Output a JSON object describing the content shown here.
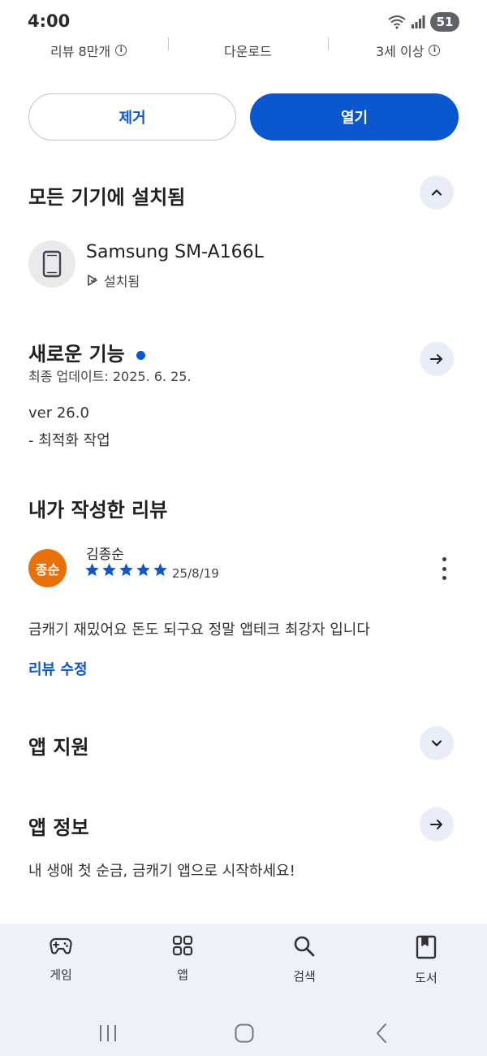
{
  "status_bar": {
    "time": "4:00",
    "battery": "51",
    "icons": [
      "wifi-icon",
      "signal-icon",
      "battery-icon"
    ]
  },
  "stats": {
    "reviews": "리뷰 8만개",
    "downloads": "다운로드",
    "rating": "3세 이상"
  },
  "actions": {
    "remove_label": "제거",
    "open_label": "열기"
  },
  "installed_section": {
    "title": "모든 기기에 설치됨",
    "device_name": "Samsung SM-A166L",
    "device_status": "설치됨"
  },
  "whats_new": {
    "title": "새로운 기능",
    "last_updated": "최종 업데이트: 2025. 6. 25.",
    "version": "ver 26.0",
    "note": "- 최적화 작업"
  },
  "my_review": {
    "title": "내가 작성한 리뷰",
    "avatar_text": "종순",
    "reviewer": "김종순",
    "stars": 5,
    "date": "25/8/19",
    "body": "금캐기 재밌어요 돈도 되구요 정말 앱테크 최강자 입니다",
    "edit_label": "리뷰 수정"
  },
  "app_support": {
    "title": "앱 지원"
  },
  "app_info": {
    "title": "앱 정보",
    "description": "내 생애 첫 순금, 금캐기 앱으로 시작하세요!"
  },
  "bottom_nav": {
    "items": [
      {
        "label": "게임",
        "icon": "gamepad-icon"
      },
      {
        "label": "앱",
        "icon": "apps-grid-icon"
      },
      {
        "label": "검색",
        "icon": "search-icon"
      },
      {
        "label": "도서",
        "icon": "book-icon"
      }
    ]
  },
  "colors": {
    "primary": "#0b57d0",
    "avatar": "#e8710a",
    "nav_bg": "#eef2f8",
    "round_button_bg": "#e8edf7"
  }
}
